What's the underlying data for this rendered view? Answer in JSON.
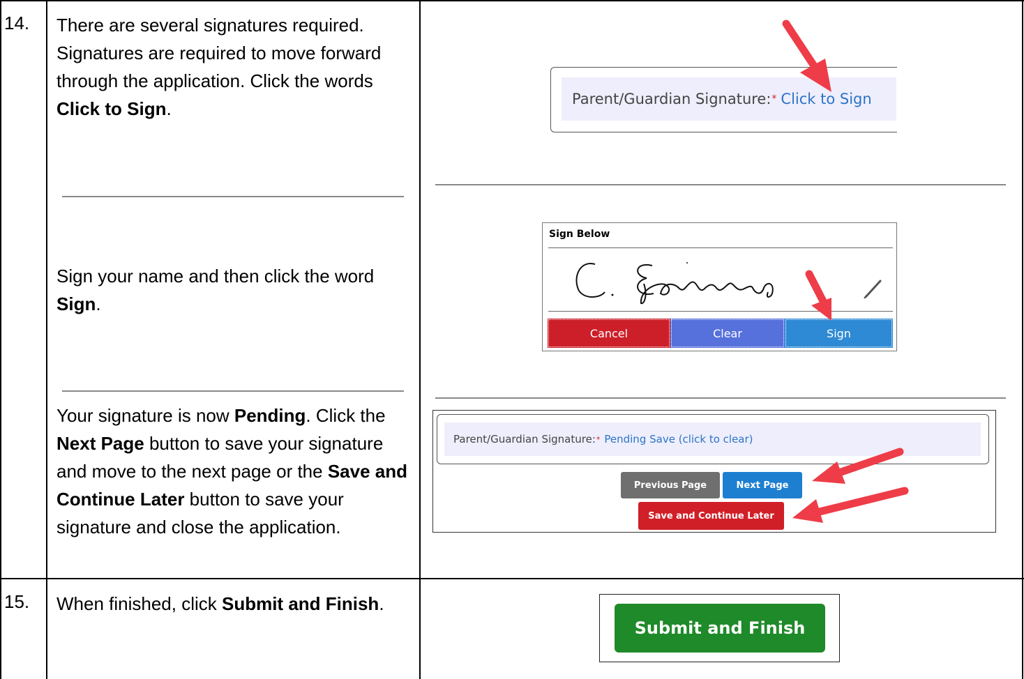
{
  "steps": [
    {
      "number": "14.",
      "parts": [
        {
          "text_1": "There are several signatures required. Signatures are required to move forward through the application. Click the words ",
          "bold_1": "Click to Sign",
          "text_2": "."
        },
        {
          "text_1": "Sign your name and then click the word ",
          "bold_1": "Sign",
          "text_2": "."
        },
        {
          "text_1": "Your signature is now ",
          "bold_1": "Pending",
          "text_2": ". Click the ",
          "bold_2": "Next Page",
          "text_3": " button to save your signature and move to the next page or the ",
          "bold_3": "Save and Continue Later",
          "text_4": " button to save your signature and close the application."
        }
      ]
    },
    {
      "number": "15.",
      "parts": [
        {
          "text_1": "When finished, click ",
          "bold_1": "Submit and Finish",
          "text_2": "."
        }
      ]
    }
  ],
  "screenshots": {
    "sign_field": {
      "label": "Parent/Guardian Signature:",
      "required_mark": "*",
      "link": "Click to Sign"
    },
    "sign_pad": {
      "header": "Sign Below",
      "signature": "C. Espinosa",
      "pen_icon": "pencil-icon",
      "buttons": {
        "cancel": "Cancel",
        "clear": "Clear",
        "sign": "Sign"
      }
    },
    "pending": {
      "label": "Parent/Guardian Signature:",
      "required_mark": "*",
      "link": "Pending Save (click to clear)",
      "buttons": {
        "previous": "Previous Page",
        "next": "Next Page",
        "save_later": "Save and Continue Later"
      }
    },
    "submit": {
      "button": "Submit and Finish"
    }
  },
  "colors": {
    "arrow": "#ee3d48",
    "cancel": "#cc1f2a",
    "clear": "#5670dc",
    "sign": "#2e8ad4",
    "previous": "#6f6f6f",
    "next": "#1e7fd0",
    "save_later": "#d11f28",
    "submit": "#1f8a29",
    "field_bg": "#eeeefc"
  }
}
